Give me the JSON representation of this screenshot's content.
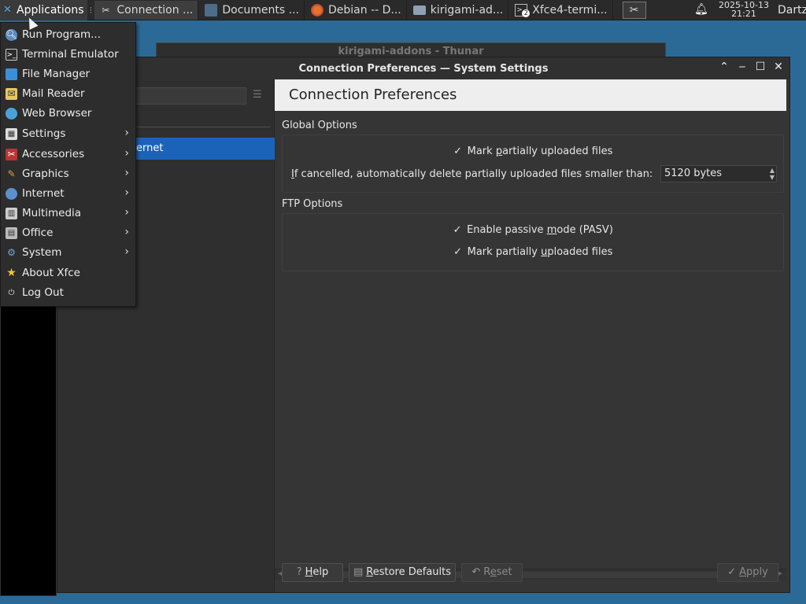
{
  "panel": {
    "applications_label": "Applications",
    "tasks": [
      {
        "label": "Connection ...",
        "icon": "tools-icon"
      },
      {
        "label": "Documents ...",
        "icon": "document-icon"
      },
      {
        "label": "Debian -- D...",
        "icon": "firefox-icon"
      },
      {
        "label": "kirigami-ad...",
        "icon": "folder-icon"
      },
      {
        "label": "Xfce4-termi...",
        "icon": "terminal-icon",
        "badge": "2"
      }
    ],
    "date": "2025-10-13",
    "time": "21:21",
    "user": "Dartz"
  },
  "background": {
    "thunar_title": "kirigami-addons - Thunar"
  },
  "window": {
    "title": "Connection Preferences — System Settings",
    "sidebar_selected": "ernet",
    "header": "Connection Preferences",
    "global_options": {
      "title": "Global Options",
      "mark_partial_pre": "Mark ",
      "mark_partial_u": "p",
      "mark_partial_post": "artially uploaded files",
      "delete_label_u": "I",
      "delete_label_post": "f cancelled, automatically delete partially uploaded files smaller than:",
      "delete_value": "5120 bytes"
    },
    "ftp_options": {
      "title": "FTP Options",
      "pasv_pre": "Enable passive ",
      "pasv_u": "m",
      "pasv_post": "ode (PASV)",
      "mark_pre": "Mark partially ",
      "mark_u": "u",
      "mark_post": "ploaded files"
    },
    "buttons": {
      "help_u": "H",
      "help_post": "elp",
      "restore_u": "R",
      "restore_post": "estore Defaults",
      "reset_pre": "R",
      "reset_u": "e",
      "reset_post": "set",
      "apply_pre": "",
      "apply_u": "A",
      "apply_post": "pply"
    }
  },
  "app_menu": {
    "items": [
      {
        "label": "Run Program...",
        "icon": "run-program-icon",
        "submenu": false
      },
      {
        "label": "Terminal Emulator",
        "icon": "terminal-icon",
        "submenu": false
      },
      {
        "label": "File Manager",
        "icon": "file-manager-icon",
        "submenu": false
      },
      {
        "label": "Mail Reader",
        "icon": "mail-icon",
        "submenu": false
      },
      {
        "label": "Web Browser",
        "icon": "web-browser-icon",
        "submenu": false
      },
      {
        "label": "Settings",
        "icon": "settings-icon",
        "submenu": true
      },
      {
        "label": "Accessories",
        "icon": "accessories-icon",
        "submenu": true
      },
      {
        "label": "Graphics",
        "icon": "graphics-icon",
        "submenu": true
      },
      {
        "label": "Internet",
        "icon": "internet-icon",
        "submenu": true
      },
      {
        "label": "Multimedia",
        "icon": "multimedia-icon",
        "submenu": true
      },
      {
        "label": "Office",
        "icon": "office-icon",
        "submenu": true
      },
      {
        "label": "System",
        "icon": "system-icon",
        "submenu": true
      },
      {
        "label": "About Xfce",
        "icon": "star-icon",
        "submenu": false
      },
      {
        "label": "Log Out",
        "icon": "logout-icon",
        "submenu": false
      }
    ]
  },
  "colors": {
    "selection": "#1b63b8",
    "desktop": "#2b6a97",
    "panel": "#2a2a2a"
  }
}
